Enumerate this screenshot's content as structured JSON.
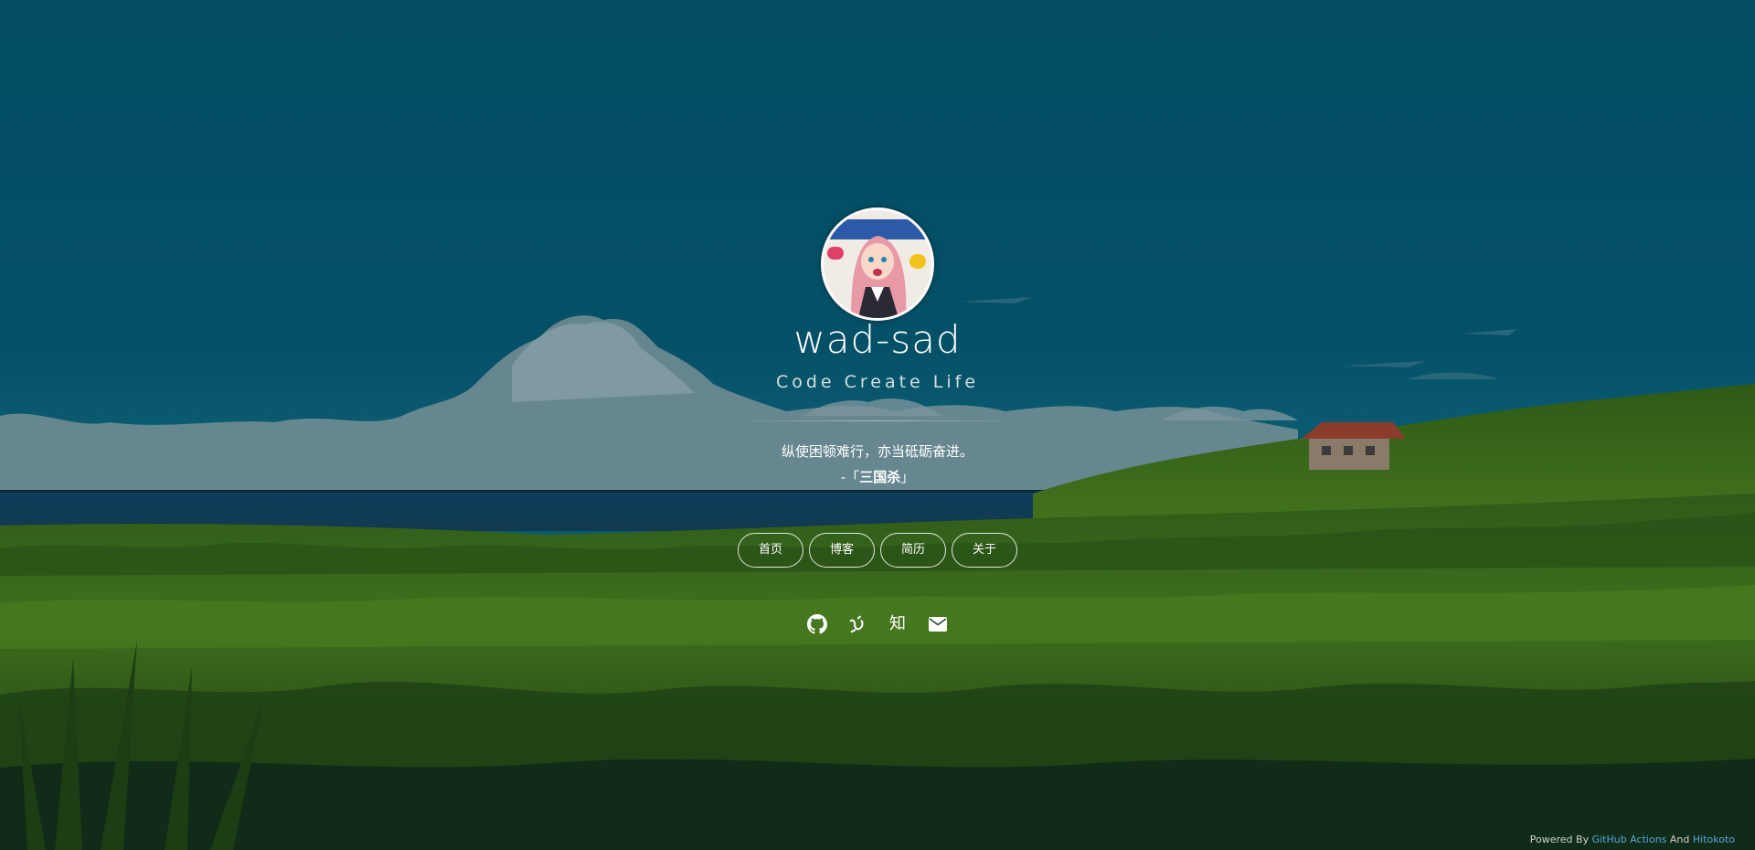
{
  "profile": {
    "name": "wad-sad",
    "motto": "Code Create Life"
  },
  "quote": {
    "text": "纵使困顿难行，亦当砥砺奋进。",
    "source_prefix": "-「",
    "source_name": "三国杀",
    "source_suffix": "」"
  },
  "nav": {
    "items": [
      {
        "label": "首页"
      },
      {
        "label": "博客"
      },
      {
        "label": "简历"
      },
      {
        "label": "关于"
      }
    ]
  },
  "social": {
    "icons": [
      "github-icon",
      "yuque-icon",
      "zhihu-icon",
      "email-icon"
    ],
    "zhihu_label": "知"
  },
  "footer": {
    "prefix": "Powered By",
    "link1": "GitHub Actions",
    "middle": "And",
    "link2": "Hitokoto"
  },
  "colors": {
    "sky": "#024d62",
    "grass": "#3f6f1c",
    "link": "#5aa5d8"
  }
}
